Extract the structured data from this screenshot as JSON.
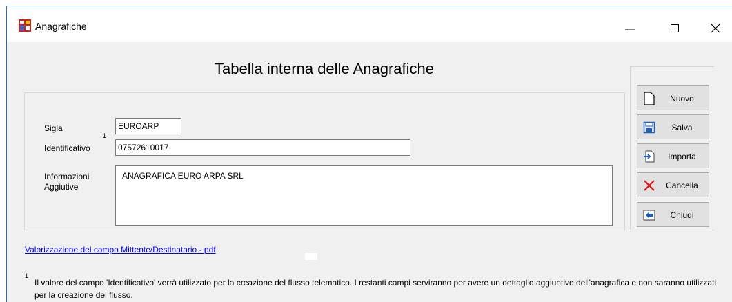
{
  "window": {
    "title": "Anagrafiche",
    "icon": "anagrafiche-app-icon",
    "controls": [
      "minimize-icon",
      "maximize-icon",
      "close-icon"
    ]
  },
  "heading": "Tabella interna delle Anagrafiche",
  "form": {
    "sigla": {
      "label": "Sigla",
      "value": "EUROARP"
    },
    "identificativo": {
      "label": "Identificativo",
      "superscript": "1",
      "value": "07572610017"
    },
    "informazioni": {
      "label_line1": "Informazioni",
      "label_line2": "Aggiutive",
      "value": "ANAGRAFICA EURO ARPA SRL"
    }
  },
  "buttons": {
    "nuovo": {
      "label": "Nuovo",
      "icon": "new-document-icon"
    },
    "salva": {
      "label": "Salva",
      "icon": "floppy-disk-icon"
    },
    "importa": {
      "label": "Importa",
      "icon": "import-icon"
    },
    "cancella": {
      "label": "Cancella",
      "icon": "red-x-icon"
    },
    "chiudi": {
      "label": "Chiudi",
      "icon": "exit-arrow-icon"
    }
  },
  "link": {
    "text": "Valorizzazione del campo Mittente/Destinatario - pdf"
  },
  "footnote": {
    "marker": "1",
    "text": "Il valore del campo 'Identificativo' verrà utilizzato per la creazione del flusso telematico. I restanti campi serviranno per avere un dettaglio aggiuntivo dell'anagrafica e non saranno utilizzati per la creazione del flusso."
  },
  "colors": {
    "window_border": "#1e6fb8",
    "dialog_bg": "#f0f0f0",
    "link": "#0000ff",
    "button_face": "#e1e1e1",
    "cancel_icon": "#e01010"
  }
}
